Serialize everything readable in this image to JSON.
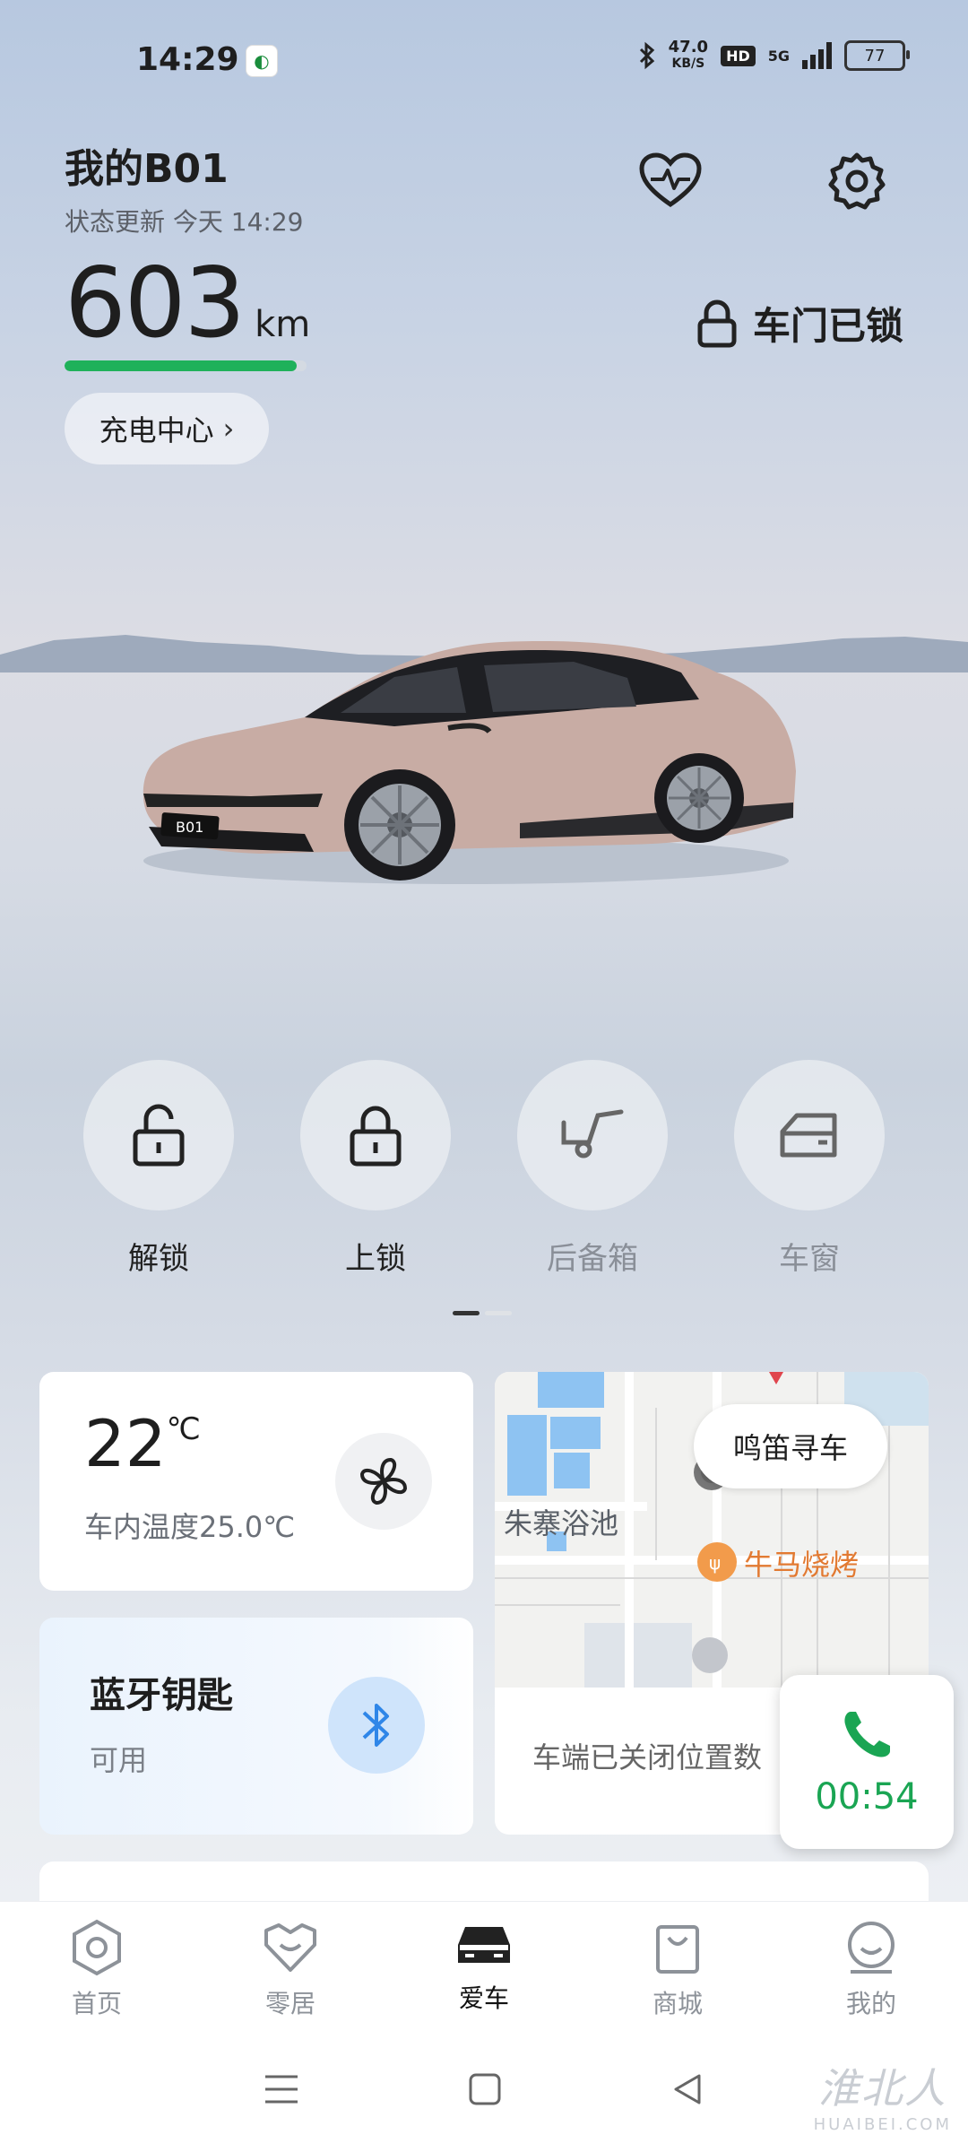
{
  "status_bar": {
    "time": "14:29",
    "net_speed_value": "47.0",
    "net_speed_unit": "KB/S",
    "hd": "HD",
    "network": "5G",
    "battery": "77"
  },
  "header": {
    "car_name": "我的B01",
    "update_text": "状态更新 今天 14:29",
    "range_value": "603",
    "range_unit": "km",
    "range_fraction": 0.96,
    "charge_center": "充电中心",
    "door_status": "车门已锁"
  },
  "car": {
    "plate": "B01"
  },
  "actions": [
    {
      "label": "解锁",
      "icon": "unlock-icon"
    },
    {
      "label": "上锁",
      "icon": "lock-icon"
    },
    {
      "label": "后备箱",
      "icon": "trunk-icon"
    },
    {
      "label": "车窗",
      "icon": "window-icon"
    }
  ],
  "climate": {
    "temp": "22",
    "unit": "℃",
    "inside": "车内温度25.0℃"
  },
  "bt_key": {
    "title": "蓝牙钥匙",
    "status": "可用"
  },
  "map": {
    "honk_button": "鸣笛寻车",
    "place_1": "朱寨浴池",
    "place_2": "牛马烧烤",
    "location_status": "车端已关闭位置数"
  },
  "call": {
    "duration": "00:54"
  },
  "tabs": [
    {
      "label": "首页",
      "icon": "home-hex-icon"
    },
    {
      "label": "零居",
      "icon": "heart-smile-icon"
    },
    {
      "label": "爱车",
      "icon": "car-icon"
    },
    {
      "label": "商城",
      "icon": "shopping-bag-icon"
    },
    {
      "label": "我的",
      "icon": "profile-icon"
    }
  ],
  "active_tab": "爱车",
  "watermark": {
    "top": "淮北人",
    "bottom": "HUAIBEI.COM"
  },
  "colors": {
    "range_bar": "#1fb15a",
    "call_green": "#1aa553",
    "bt_blue": "#2f86e8"
  }
}
